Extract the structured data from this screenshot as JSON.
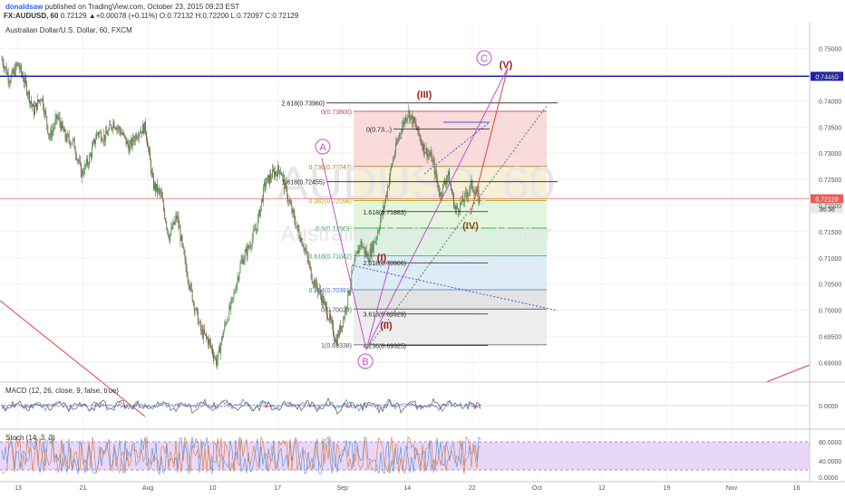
{
  "header": {
    "author": "donaldsaw",
    "published": "published on TradingView.com, October 23, 2015 09:23 EST",
    "symbol": "FX:AUDUSD, 60",
    "quote": "0.72129 ▲+0.00078 (+0.11%) O:0.72132 H:0.72200 L:0.72097 C:0.72129"
  },
  "chart_data": {
    "type": "line",
    "title": "Australian Dollar/U.S. Dollar, 60, FXCM",
    "watermark_line1": "AUDUSD, 60",
    "watermark_line2": "Australian Dollar/U.S. Dollar",
    "ylim": [
      0.688,
      0.752
    ],
    "y_ticks": [
      "0.75000",
      "0.74500",
      "0.74000",
      "0.73500",
      "0.73000",
      "0.72500",
      "0.72000",
      "0.71500",
      "0.71000",
      "0.70500",
      "0.70000",
      "0.69500",
      "0.69000"
    ],
    "x_ticks": [
      "13",
      "21",
      "Aug",
      "10",
      "17",
      "Sep",
      "14",
      "22",
      "Oct",
      "12",
      "19",
      "Nov",
      "16"
    ],
    "price_series_anchors": [
      0.748,
      0.744,
      0.747,
      0.743,
      0.738,
      0.741,
      0.733,
      0.737,
      0.733,
      0.732,
      0.726,
      0.729,
      0.734,
      0.733,
      0.736,
      0.734,
      0.731,
      0.734,
      0.735,
      0.724,
      0.722,
      0.714,
      0.718,
      0.709,
      0.702,
      0.696,
      0.694,
      0.69,
      0.697,
      0.702,
      0.709,
      0.712,
      0.716,
      0.724,
      0.726,
      0.727,
      0.721,
      0.716,
      0.712,
      0.706,
      0.703,
      0.699,
      0.694,
      0.699,
      0.707,
      0.713,
      0.71,
      0.714,
      0.72,
      0.728,
      0.734,
      0.738,
      0.735,
      0.731,
      0.729,
      0.722,
      0.726,
      0.719,
      0.721,
      0.724,
      0.721
    ],
    "horizontal_levels": [
      {
        "price": 0.74469,
        "label": "0.74469",
        "color": "#1e22aa"
      },
      {
        "price": 0.72129,
        "label": "0.72129",
        "color": "#e35d5b"
      }
    ],
    "last_price_label": "0.72129",
    "timer_label": "36:38",
    "fib_retracement": [
      {
        "label": "0(0.73800)",
        "price": 0.738
      },
      {
        "label": "0.236(0.72747)",
        "price": 0.72747
      },
      {
        "label": "0.382(0.72096)",
        "price": 0.72096
      },
      {
        "label": "0.5(0.71569)",
        "price": 0.71569
      },
      {
        "label": "0.618(0.71042)",
        "price": 0.71042
      },
      {
        "label": "0.764(0.70391)",
        "price": 0.70391
      },
      {
        "label": "0(0.70023)",
        "price": 0.70023
      },
      {
        "label": "1(0.69338)",
        "price": 0.69338
      }
    ],
    "fib_extensions": [
      {
        "label": "2.618(0.73960)",
        "price": 0.7396
      },
      {
        "label": "1.618(0.72455)",
        "price": 0.72455
      },
      {
        "label": "0(0.73...)",
        "price": 0.7346
      },
      {
        "label": "1.618(0.71883)",
        "price": 0.71883
      },
      {
        "label": "2.618(0.70906)",
        "price": 0.70906
      },
      {
        "label": "3.618(0.69929)",
        "price": 0.69929
      },
      {
        "label": "4.236(0.69325)",
        "price": 0.69325
      }
    ],
    "wave_labels": [
      {
        "text": "A",
        "color": "#c34fc9",
        "circled": true
      },
      {
        "text": "B",
        "color": "#c34fc9",
        "circled": true
      },
      {
        "text": "C",
        "color": "#c34fc9",
        "circled": true
      },
      {
        "text": "(I)",
        "color": "#a61c1c"
      },
      {
        "text": "(II)",
        "color": "#a61c1c"
      },
      {
        "text": "(III)",
        "color": "#a61c1c"
      },
      {
        "text": "(IV)",
        "color": "#8a4b08"
      },
      {
        "text": "(V)",
        "color": "#a61c1c"
      }
    ],
    "macd": {
      "label": "MACD (12, 26, close, 9, false, true)",
      "y_ticks": [
        "0.0000"
      ]
    },
    "stoch": {
      "label": "Stoch (14, 3, 3)",
      "y_ticks": [
        "80.0000",
        "40.0000",
        "0.0000"
      ]
    }
  }
}
